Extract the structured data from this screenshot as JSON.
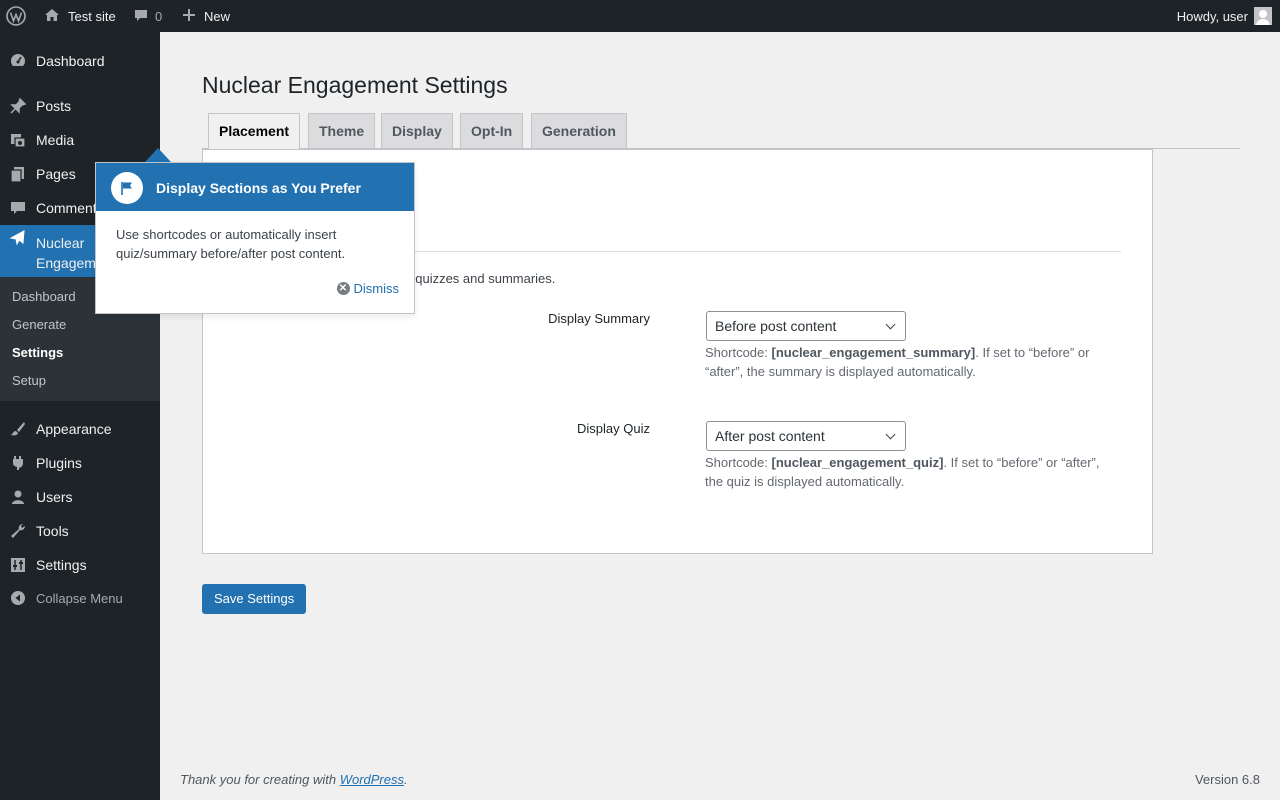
{
  "adminbar": {
    "site_name": "Test site",
    "comments_count": "0",
    "new_label": "New",
    "howdy": "Howdy, user"
  },
  "sidebar": {
    "items": [
      {
        "label": "Dashboard",
        "icon": "dashboard-icon"
      },
      {
        "label": "Posts",
        "icon": "pin-icon"
      },
      {
        "label": "Media",
        "icon": "media-icon"
      },
      {
        "label": "Pages",
        "icon": "pages-icon"
      },
      {
        "label": "Comments",
        "icon": "comment-icon"
      },
      {
        "label": "Nuclear Engagement",
        "icon": "plane-icon"
      },
      {
        "label": "Appearance",
        "icon": "brush-icon"
      },
      {
        "label": "Plugins",
        "icon": "plug-icon"
      },
      {
        "label": "Users",
        "icon": "user-icon"
      },
      {
        "label": "Tools",
        "icon": "wrench-icon"
      },
      {
        "label": "Settings",
        "icon": "sliders-icon"
      }
    ],
    "submenu": [
      "Dashboard",
      "Generate",
      "Settings",
      "Setup"
    ],
    "collapse_label": "Collapse Menu"
  },
  "page": {
    "title": "Nuclear Engagement Settings",
    "tabs": [
      "Placement",
      "Theme",
      "Display",
      "Opt-In",
      "Generation"
    ],
    "active_tab": "Placement",
    "section_desc": "lay quizzes and summaries. ",
    "fields": [
      {
        "label": "Display Summary",
        "value": "Before post content",
        "help_prefix": "Shortcode: ",
        "help_code": "[nuclear_engagement_summary]",
        "help_suffix": ". If set to “before” or “after”, the summary is displayed automatically."
      },
      {
        "label": "Display Quiz",
        "value": "After post content",
        "help_prefix": "Shortcode: ",
        "help_code": "[nuclear_engagement_quiz]",
        "help_suffix": ". If set to “before” or “after”, the quiz is displayed automatically."
      }
    ],
    "save_label": "Save Settings"
  },
  "pointer": {
    "title": "Display Sections as You Prefer",
    "body": "Use shortcodes or automatically insert quiz/summary before/after post content.",
    "dismiss": "Dismiss"
  },
  "footer": {
    "thanks_prefix": "Thank you for creating with ",
    "thanks_link": "WordPress",
    "thanks_suffix": ".",
    "version": "Version 6.8"
  },
  "colors": {
    "accent": "#2271b1",
    "sidebar_bg": "#1d2327",
    "page_bg": "#f0f0f1"
  }
}
